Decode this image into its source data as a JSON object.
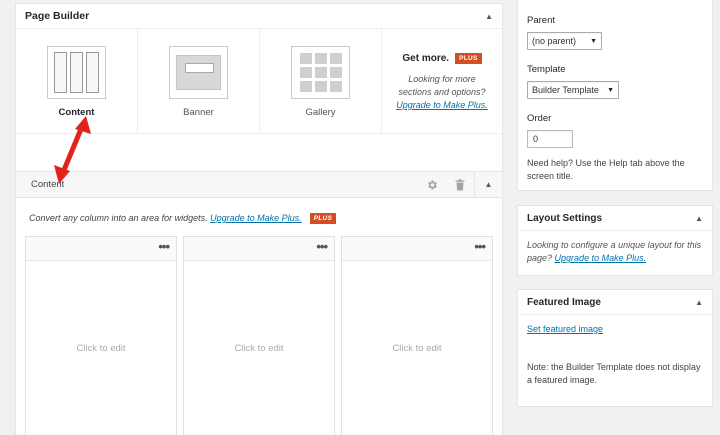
{
  "page_builder": {
    "title": "Page Builder",
    "sections": [
      {
        "label": "Content"
      },
      {
        "label": "Banner"
      },
      {
        "label": "Gallery"
      }
    ],
    "get_more": {
      "title": "Get more.",
      "badge": "PLUS",
      "text": "Looking for more sections and options?",
      "link": "Upgrade to Make Plus."
    },
    "content_bar": {
      "label": "Content"
    },
    "notice": {
      "text": "Convert any column into an area for widgets.",
      "link": "Upgrade to Make Plus.",
      "badge": "PLUS"
    },
    "columns": [
      {
        "menu": "•••",
        "placeholder": "Click to edit"
      },
      {
        "menu": "•••",
        "placeholder": "Click to edit"
      },
      {
        "menu": "•••",
        "placeholder": "Click to edit"
      }
    ]
  },
  "page_attributes": {
    "parent_label": "Parent",
    "parent_value": "(no parent)",
    "template_label": "Template",
    "template_value": "Builder Template",
    "order_label": "Order",
    "order_value": "0",
    "help": "Need help? Use the Help tab above the screen title."
  },
  "layout_settings": {
    "title": "Layout Settings",
    "text": "Looking to configure a unique layout for this page?",
    "link": "Upgrade to Make Plus."
  },
  "featured_image": {
    "title": "Featured Image",
    "link": "Set featured image",
    "note": "Note: the Builder Template does not display a featured image."
  },
  "colors": {
    "link": "#0073aa",
    "badge": "#d54e21",
    "arrow": "#e0241b"
  },
  "icons": [
    "caret-up-icon",
    "gear-icon",
    "trash-icon",
    "ellipsis-icon",
    "chevron-down-icon"
  ]
}
